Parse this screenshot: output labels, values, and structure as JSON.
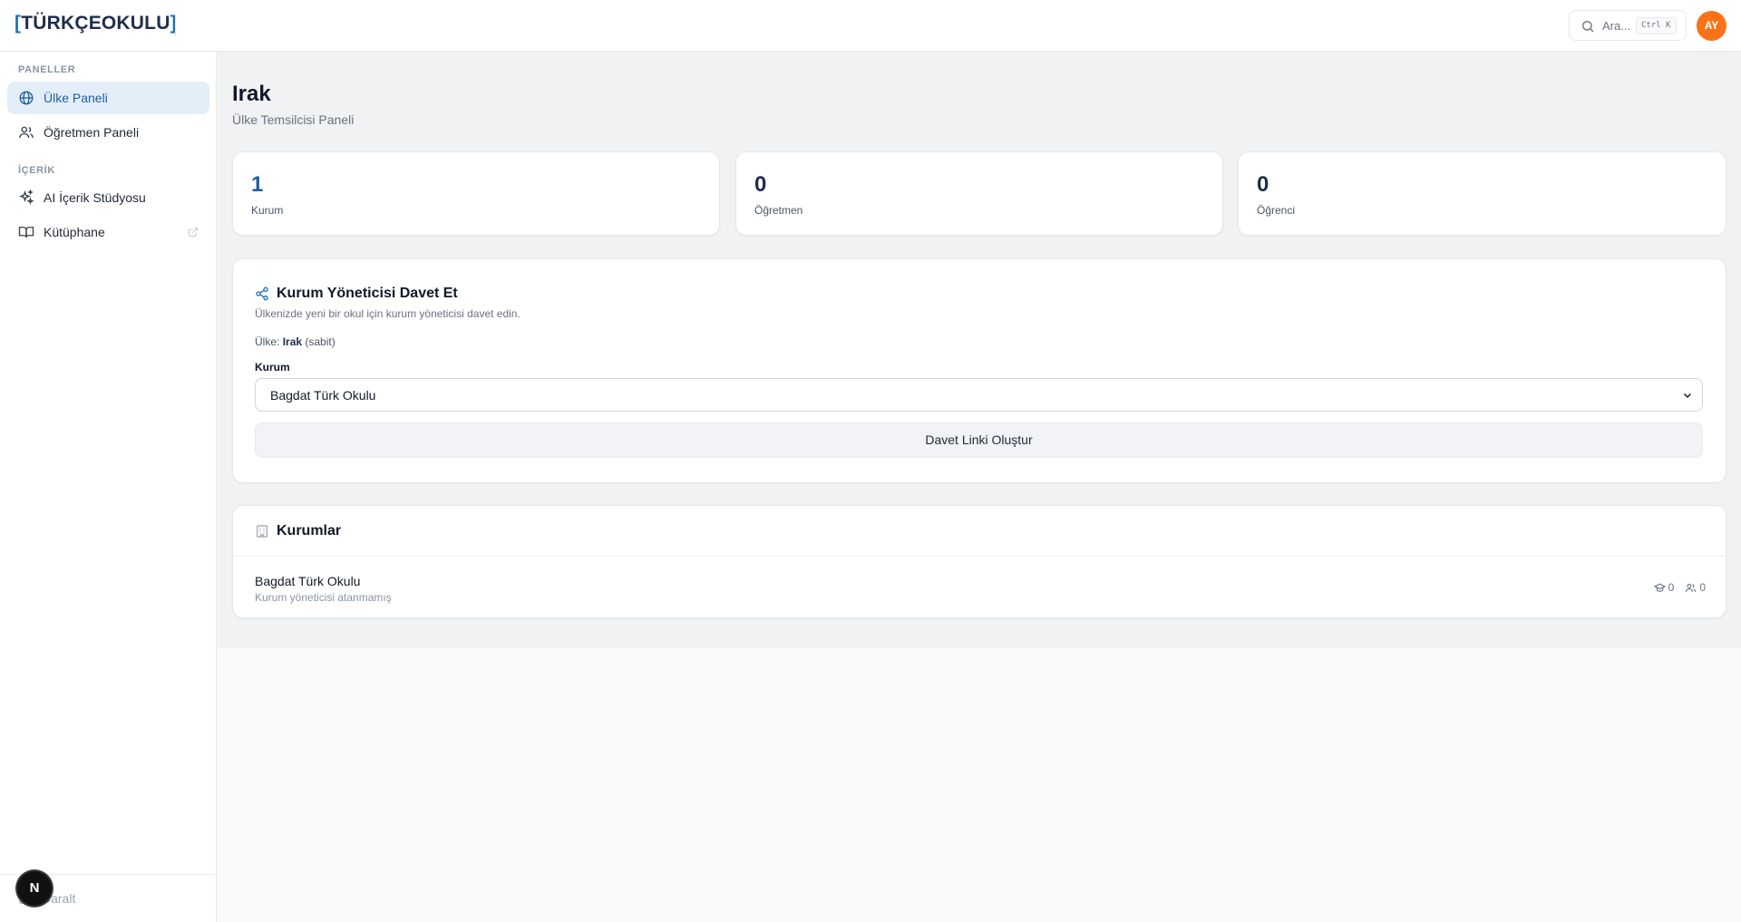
{
  "brand": {
    "bracket_open": "[",
    "name": "TÜRKÇEOKULU",
    "bracket_close": "]"
  },
  "header": {
    "search_placeholder": "Ara...",
    "search_shortcut": "Ctrl K",
    "avatar_initials": "AY"
  },
  "sidebar": {
    "sections": [
      {
        "label": "PANELLER",
        "items": [
          {
            "label": "Ülke Paneli",
            "icon": "globe-icon",
            "active": true
          },
          {
            "label": "Öğretmen Paneli",
            "icon": "users-icon",
            "active": false
          }
        ]
      },
      {
        "label": "İÇERİK",
        "items": [
          {
            "label": "AI İçerik Stüdyosu",
            "icon": "sparkles-icon",
            "active": false
          },
          {
            "label": "Kütüphane",
            "icon": "book-icon",
            "active": false,
            "external": true
          }
        ]
      }
    ],
    "collapse_label": "Daralt",
    "dev_badge": "N"
  },
  "page": {
    "title": "Irak",
    "subtitle": "Ülke Temsilcisi Paneli"
  },
  "stats": [
    {
      "value": "1",
      "label": "Kurum"
    },
    {
      "value": "0",
      "label": "Öğretmen"
    },
    {
      "value": "0",
      "label": "Öğrenci"
    }
  ],
  "invite": {
    "title": "Kurum Yöneticisi Davet Et",
    "description": "Ülkenizde yeni bir okul için kurum yöneticisi davet edin.",
    "country_prefix": "Ülke:",
    "country_name": "Irak",
    "country_suffix": "(sabit)",
    "field_label": "Kurum",
    "selected_institution": "Bagdat Türk Okulu",
    "button_label": "Davet Linki Oluştur"
  },
  "institutions": {
    "title": "Kurumlar",
    "rows": [
      {
        "name": "Bagdat Türk Okulu",
        "subtitle": "Kurum yöneticisi atanmamış",
        "students": "0",
        "teachers": "0"
      }
    ]
  },
  "colors": {
    "accent": "#1d5f9e",
    "active_bg": "#e3eef8",
    "avatar": "#f97316",
    "brand_dark": "#1f2d4d"
  }
}
